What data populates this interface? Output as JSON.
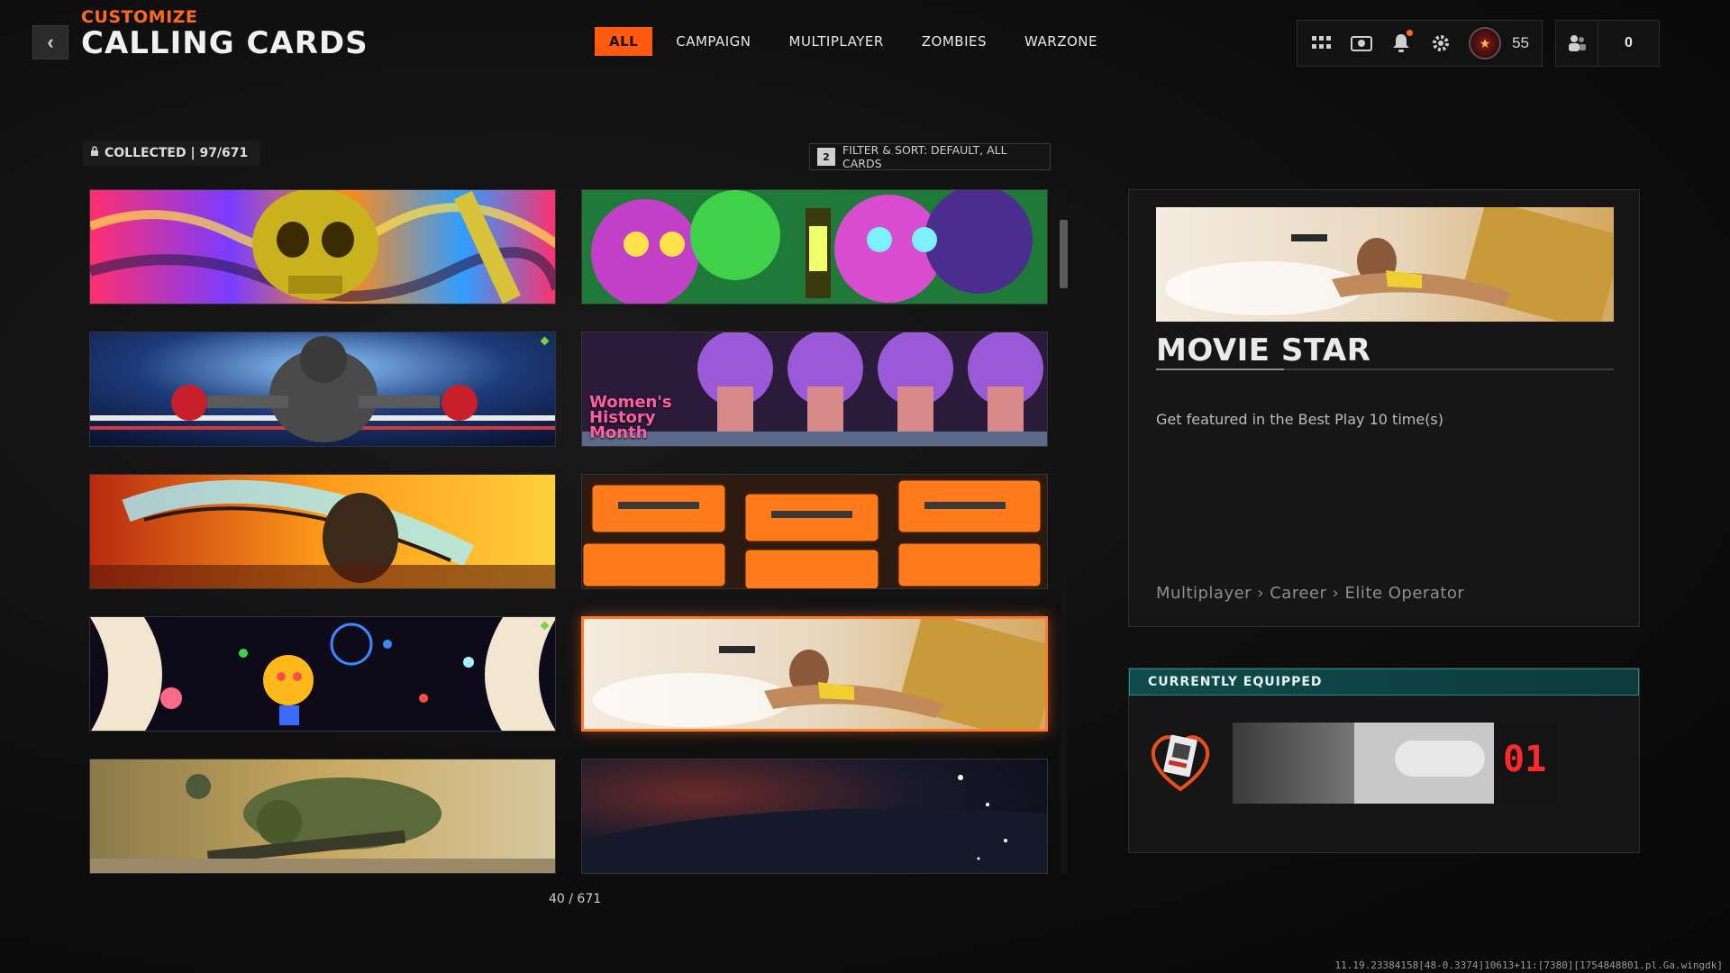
{
  "header": {
    "subtitle": "CUSTOMIZE",
    "title": "CALLING CARDS",
    "back_icon": "chevron-left-icon"
  },
  "tabs": [
    {
      "label": "ALL",
      "active": true
    },
    {
      "label": "CAMPAIGN",
      "active": false
    },
    {
      "label": "MULTIPLAYER",
      "active": false
    },
    {
      "label": "ZOMBIES",
      "active": false
    },
    {
      "label": "WARZONE",
      "active": false
    }
  ],
  "hud": {
    "level": "55",
    "friends_count": "0"
  },
  "collection": {
    "collected_label": "COLLECTED | 97/671",
    "filter_key": "2",
    "filter_label": "FILTER & SORT: DEFAULT, ALL CARDS"
  },
  "cards": [
    {
      "label": "",
      "theme": "psychedelic-skull",
      "new": false
    },
    {
      "label": "",
      "theme": "neon-skulls-lantern",
      "new": false
    },
    {
      "label": "",
      "theme": "boxing-cat",
      "new": true
    },
    {
      "label": "Women's History Month",
      "theme": "helmet-profiles",
      "new": false
    },
    {
      "label": "",
      "theme": "blade-slash",
      "new": false
    },
    {
      "label": "",
      "theme": "orange-weapon-crates",
      "new": false
    },
    {
      "label": "",
      "theme": "cosmic-sun-character",
      "new": true
    },
    {
      "label": "",
      "theme": "movie-star",
      "new": false,
      "selected": true
    },
    {
      "label": "",
      "theme": "fallen-soldier",
      "new": false
    },
    {
      "label": "",
      "theme": "dark-space",
      "new": false
    }
  ],
  "pager": "40 / 671",
  "detail": {
    "name": "MOVIE STAR",
    "description": "Get featured in the Best Play 10 time(s)",
    "path": "Multiplayer › Career › Elite Operator"
  },
  "equipped": {
    "heading": "CURRENTLY EQUIPPED",
    "card_counter": "01"
  },
  "debug_text": "11.19.23384158[48-0.3374]10613+11:[7380][1754848801.pl.Ga.wingdk]",
  "colors": {
    "accent": "#ff5a10",
    "equipped_header": "#0f4c4c",
    "new_indicator": "#7ad33d"
  }
}
